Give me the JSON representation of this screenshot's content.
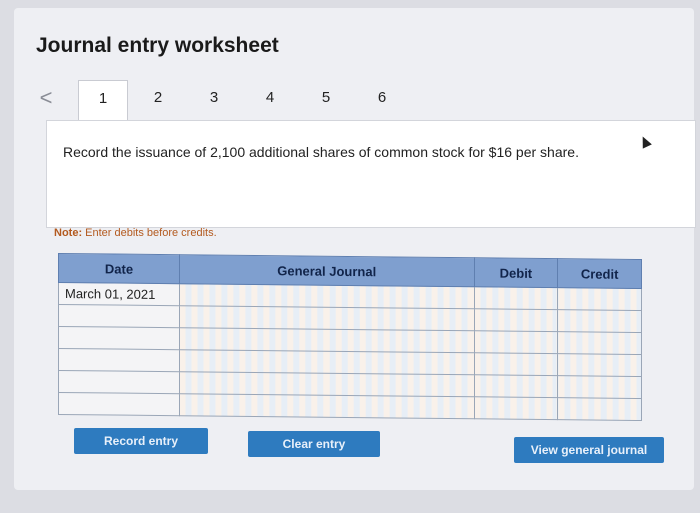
{
  "header": {
    "title": "Journal entry worksheet"
  },
  "tabs": {
    "prev_glyph": "<",
    "items": [
      "1",
      "2",
      "3",
      "4",
      "5",
      "6"
    ],
    "active": "1"
  },
  "question": {
    "text": "Record the issuance of 2,100 additional shares of common stock for $16 per share."
  },
  "note": {
    "label": "Note:",
    "text": " Enter debits before credits."
  },
  "table": {
    "columns": [
      "Date",
      "General Journal",
      "Debit",
      "Credit"
    ],
    "rows": [
      [
        "March 01, 2021",
        "",
        "",
        ""
      ],
      [
        "",
        "",
        "",
        ""
      ],
      [
        "",
        "",
        "",
        ""
      ],
      [
        "",
        "",
        "",
        ""
      ],
      [
        "",
        "",
        "",
        ""
      ],
      [
        "",
        "",
        "",
        ""
      ]
    ]
  },
  "buttons": {
    "record": "Record entry",
    "clear": "Clear entry",
    "view": "View general journal"
  },
  "colors": {
    "header_bg": "#7f9fcf",
    "button_bg": "#2e7bbf",
    "note": "#b35a1f"
  }
}
